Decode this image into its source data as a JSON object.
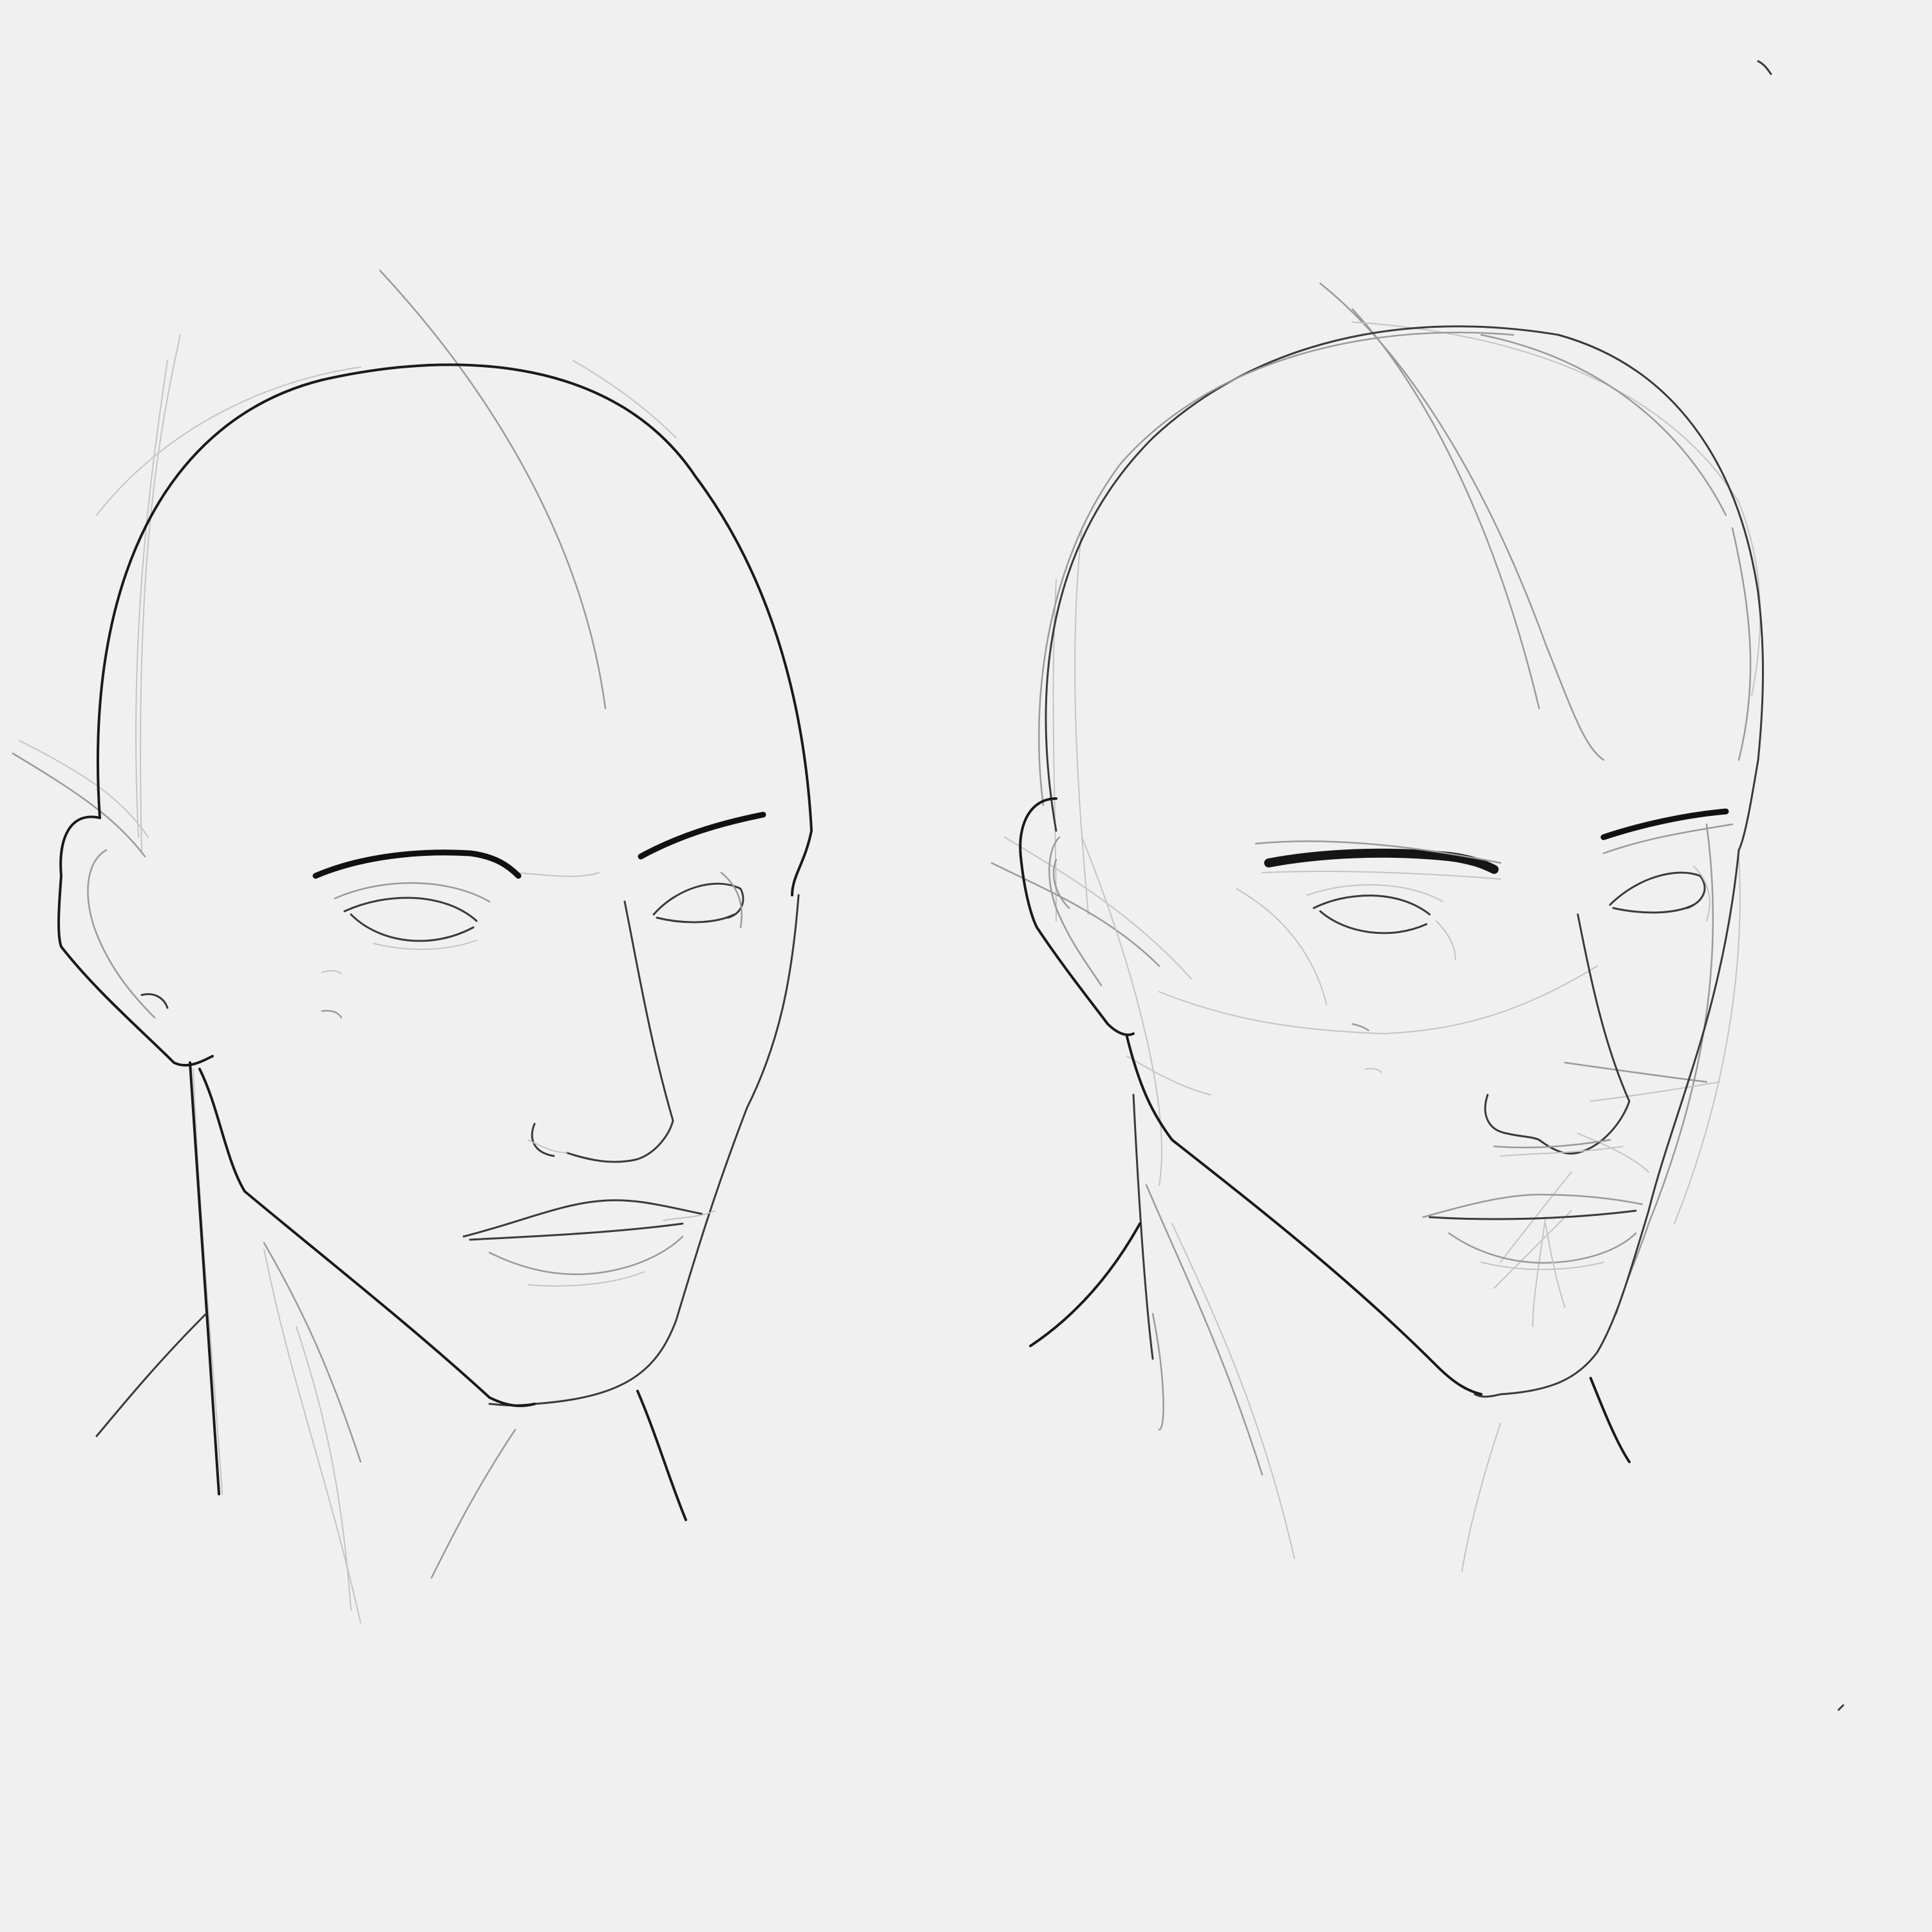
{
  "drawing": {
    "background_color": "#f0f0f0",
    "ink_color": "#1a1a1a",
    "sketch_color": "#9a9a9a",
    "figures": [
      {
        "subject": "head-sketch-left"
      },
      {
        "subject": "head-sketch-right"
      }
    ]
  }
}
